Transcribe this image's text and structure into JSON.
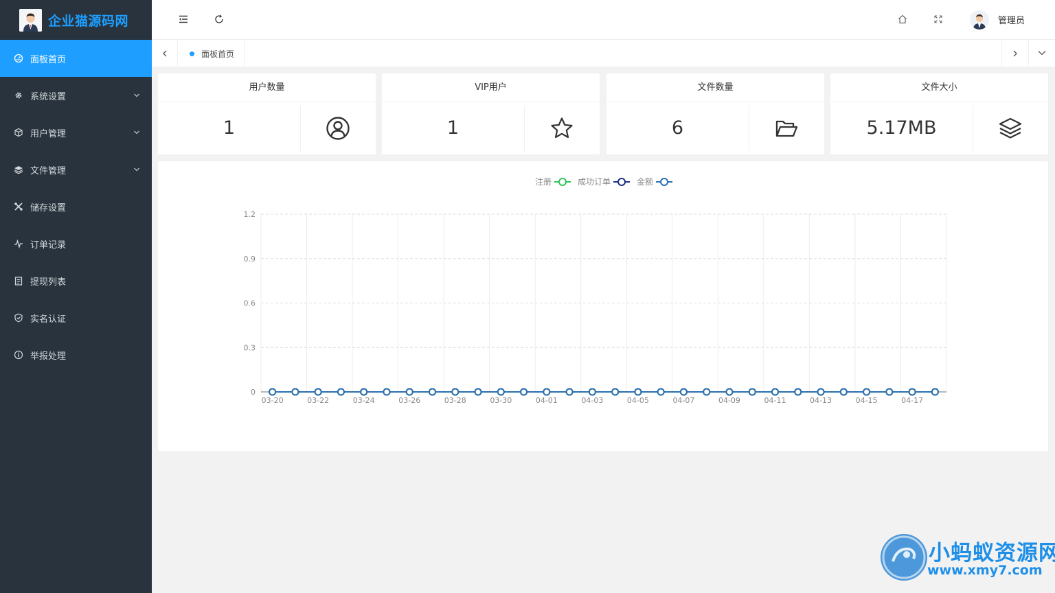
{
  "sidebar": {
    "logo_text": "企业猫源码网",
    "items": [
      {
        "label": "面板首页",
        "icon": "dashboard-icon",
        "active": true,
        "expandable": false
      },
      {
        "label": "系统设置",
        "icon": "gear-icon",
        "active": false,
        "expandable": true
      },
      {
        "label": "用户管理",
        "icon": "cube-icon",
        "active": false,
        "expandable": true
      },
      {
        "label": "文件管理",
        "icon": "layers-icon",
        "active": false,
        "expandable": true
      },
      {
        "label": "储存设置",
        "icon": "tools-icon",
        "active": false,
        "expandable": false
      },
      {
        "label": "订单记录",
        "icon": "pulse-icon",
        "active": false,
        "expandable": false
      },
      {
        "label": "提现列表",
        "icon": "clipboard-icon",
        "active": false,
        "expandable": false
      },
      {
        "label": "实名认证",
        "icon": "shield-check-icon",
        "active": false,
        "expandable": false
      },
      {
        "label": "举报处理",
        "icon": "info-circle-icon",
        "active": false,
        "expandable": false
      }
    ]
  },
  "header": {
    "admin_name": "管理员"
  },
  "tabs": {
    "active_tab": "面板首页"
  },
  "cards": [
    {
      "title": "用户数量",
      "value": "1",
      "icon": "user-circle-icon"
    },
    {
      "title": "VIP用户",
      "value": "1",
      "icon": "star-icon"
    },
    {
      "title": "文件数量",
      "value": "6",
      "icon": "folder-open-icon"
    },
    {
      "title": "文件大小",
      "value": "5.17MB",
      "icon": "layers-icon"
    }
  ],
  "chart_data": {
    "type": "line",
    "legend_position": "top-center",
    "x": [
      "03-20",
      "03-21",
      "03-22",
      "03-23",
      "03-24",
      "03-25",
      "03-26",
      "03-27",
      "03-28",
      "03-29",
      "03-30",
      "03-31",
      "04-01",
      "04-02",
      "04-03",
      "04-04",
      "04-05",
      "04-06",
      "04-07",
      "04-08",
      "04-09",
      "04-10",
      "04-11",
      "04-12",
      "04-13",
      "04-14",
      "04-15",
      "04-16",
      "04-17",
      "04-18"
    ],
    "x_tick_labels": [
      "03-20",
      "03-22",
      "03-24",
      "03-26",
      "03-28",
      "03-30",
      "04-01",
      "04-03",
      "04-05",
      "04-07",
      "04-09",
      "04-11",
      "04-13",
      "04-15",
      "04-17"
    ],
    "y_ticks": [
      0,
      0.3,
      0.6,
      0.9,
      1.2
    ],
    "ylim": [
      0,
      1.2
    ],
    "grid": true,
    "series": [
      {
        "name": "注册",
        "color": "#2ec45b",
        "values": [
          0,
          0,
          0,
          0,
          0,
          0,
          0,
          0,
          0,
          0,
          0,
          0,
          0,
          0,
          0,
          0,
          0,
          0,
          0,
          0,
          0,
          0,
          0,
          0,
          0,
          0,
          0,
          0,
          0,
          0
        ]
      },
      {
        "name": "成功订单",
        "color": "#1f2f8a",
        "values": [
          0,
          0,
          0,
          0,
          0,
          0,
          0,
          0,
          0,
          0,
          0,
          0,
          0,
          0,
          0,
          0,
          0,
          0,
          0,
          0,
          0,
          0,
          0,
          0,
          0,
          0,
          0,
          0,
          0,
          0
        ]
      },
      {
        "name": "金额",
        "color": "#2a6fb0",
        "values": [
          0,
          0,
          0,
          0,
          0,
          0,
          0,
          0,
          0,
          0,
          0,
          0,
          0,
          0,
          0,
          0,
          0,
          0,
          0,
          0,
          0,
          0,
          0,
          0,
          0,
          0,
          0,
          0,
          0,
          0
        ]
      }
    ]
  },
  "watermark": {
    "title": "小蚂蚁资源网",
    "url": "www.xmy7.com"
  }
}
